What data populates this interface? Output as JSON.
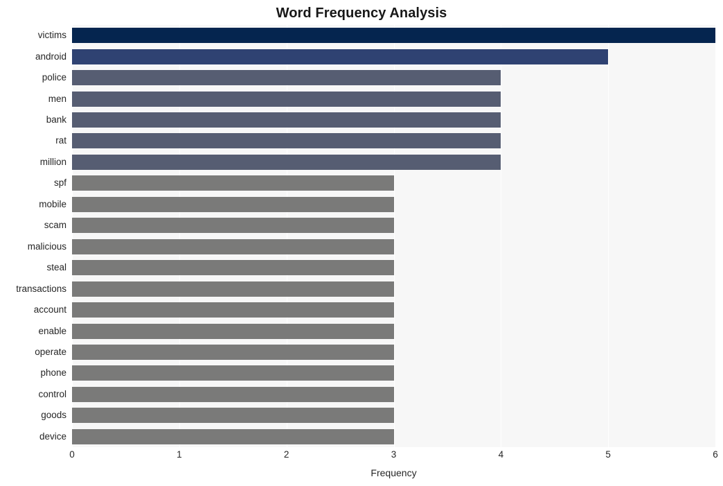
{
  "chart_data": {
    "type": "bar",
    "orientation": "horizontal",
    "title": "Word Frequency Analysis",
    "xlabel": "Frequency",
    "ylabel": "",
    "xlim": [
      0,
      6
    ],
    "xticks": [
      0,
      1,
      2,
      3,
      4,
      5,
      6
    ],
    "xtick_labels": [
      "0",
      "1",
      "2",
      "3",
      "4",
      "5",
      "6"
    ],
    "grid": true,
    "grid_axis": "both",
    "legend": null,
    "plot_background": "#f7f7f7",
    "figure_background": "#ffffff",
    "gridline_color": "#ffffff",
    "categories": [
      "victims",
      "android",
      "police",
      "men",
      "bank",
      "rat",
      "million",
      "spf",
      "mobile",
      "scam",
      "malicious",
      "steal",
      "transactions",
      "account",
      "enable",
      "operate",
      "phone",
      "control",
      "goods",
      "device"
    ],
    "values": [
      6,
      5,
      4,
      4,
      4,
      4,
      4,
      3,
      3,
      3,
      3,
      3,
      3,
      3,
      3,
      3,
      3,
      3,
      3,
      3
    ],
    "bar_colors": [
      "#05254f",
      "#2f4272",
      "#565d72",
      "#565d72",
      "#565d72",
      "#565d72",
      "#565d72",
      "#7a7a79",
      "#7a7a79",
      "#7a7a79",
      "#7a7a79",
      "#7a7a79",
      "#7a7a79",
      "#7a7a79",
      "#7a7a79",
      "#7a7a79",
      "#7a7a79",
      "#7a7a79",
      "#7a7a79",
      "#7a7a79"
    ]
  }
}
